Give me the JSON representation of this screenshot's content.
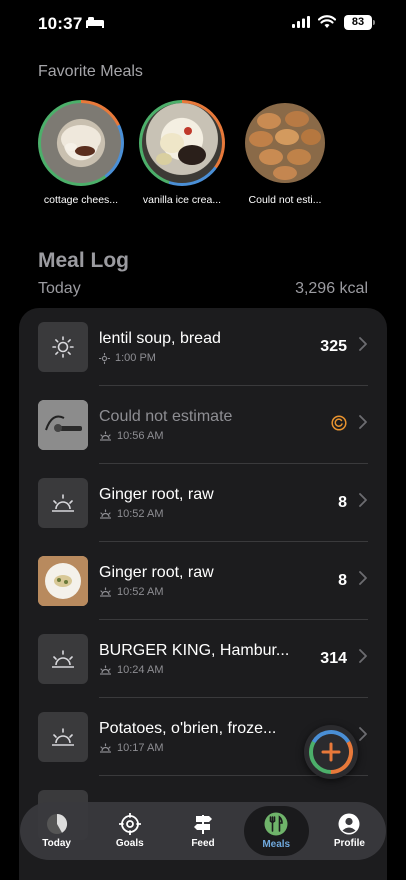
{
  "status": {
    "time": "10:37",
    "battery": "83"
  },
  "favorites": {
    "title": "Favorite Meals",
    "items": [
      {
        "label": "cottage chees..."
      },
      {
        "label": "vanilla ice crea..."
      },
      {
        "label": "Could not esti..."
      }
    ]
  },
  "log": {
    "title": "Meal Log",
    "day": "Today",
    "total": "3,296 kcal",
    "entries": [
      {
        "name": "lentil soup, bread",
        "time": "1:00 PM",
        "kcal": "325"
      },
      {
        "name": "Could not estimate",
        "time": "10:56 AM",
        "kcal": ""
      },
      {
        "name": "Ginger root, raw",
        "time": "10:52 AM",
        "kcal": "8"
      },
      {
        "name": "Ginger root, raw",
        "time": "10:52 AM",
        "kcal": "8"
      },
      {
        "name": "BURGER KING, Hambur...",
        "time": "10:24 AM",
        "kcal": "314"
      },
      {
        "name": "Potatoes, o'brien, froze...",
        "time": "10:17 AM",
        "kcal": ""
      }
    ]
  },
  "tabs": [
    {
      "label": "Today"
    },
    {
      "label": "Goals"
    },
    {
      "label": "Feed"
    },
    {
      "label": "Meals"
    },
    {
      "label": "Profile"
    }
  ],
  "colors": {
    "accent_blue": "#6fa8dc",
    "ring_green": "#4caf6a",
    "ring_orange": "#e8793a",
    "ring_blue": "#4a8fd6"
  }
}
